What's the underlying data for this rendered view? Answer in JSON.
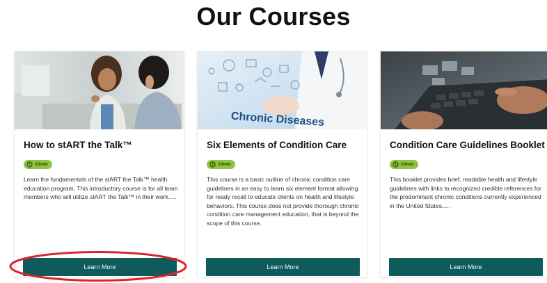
{
  "page": {
    "title": "Our Courses"
  },
  "colors": {
    "button_bg": "#0f5a5a",
    "badge_bg": "#8dc53e",
    "highlight_ring": "#d9262c"
  },
  "courses": [
    {
      "title": "How to stART the Talk™",
      "duration": "10min",
      "description": "Learn the fundamentals of the stART the Talk™ health education program. This introductory course is for all team members who will utilize stART the Talk™ in their work.....",
      "button_label": "Learn More",
      "image_icon": "photo-two-women-talking"
    },
    {
      "title": "Six Elements of Condition Care",
      "duration": "10min",
      "description": "This course is a basic outline of chronic condition care guidelines in an easy to learn six element format allowing for ready recall to educate clients on health and lifestyle behaviors. This course does not provide thorough chronic condition care management education, that is beyond the scope of this course.",
      "button_label": "Learn More",
      "image_text": "Chronic Diseases",
      "image_icon": "photo-doctor-chronic-diseases"
    },
    {
      "title": "Condition Care Guidelines Booklet",
      "duration": "10min",
      "description": "This booklet provides brief, readable health and lifestyle guidelines with links to recognized credible references for the predominant chronic conditions currently experienced in the United States.....",
      "button_label": "Learn More",
      "image_icon": "photo-hands-on-keyboard"
    }
  ]
}
